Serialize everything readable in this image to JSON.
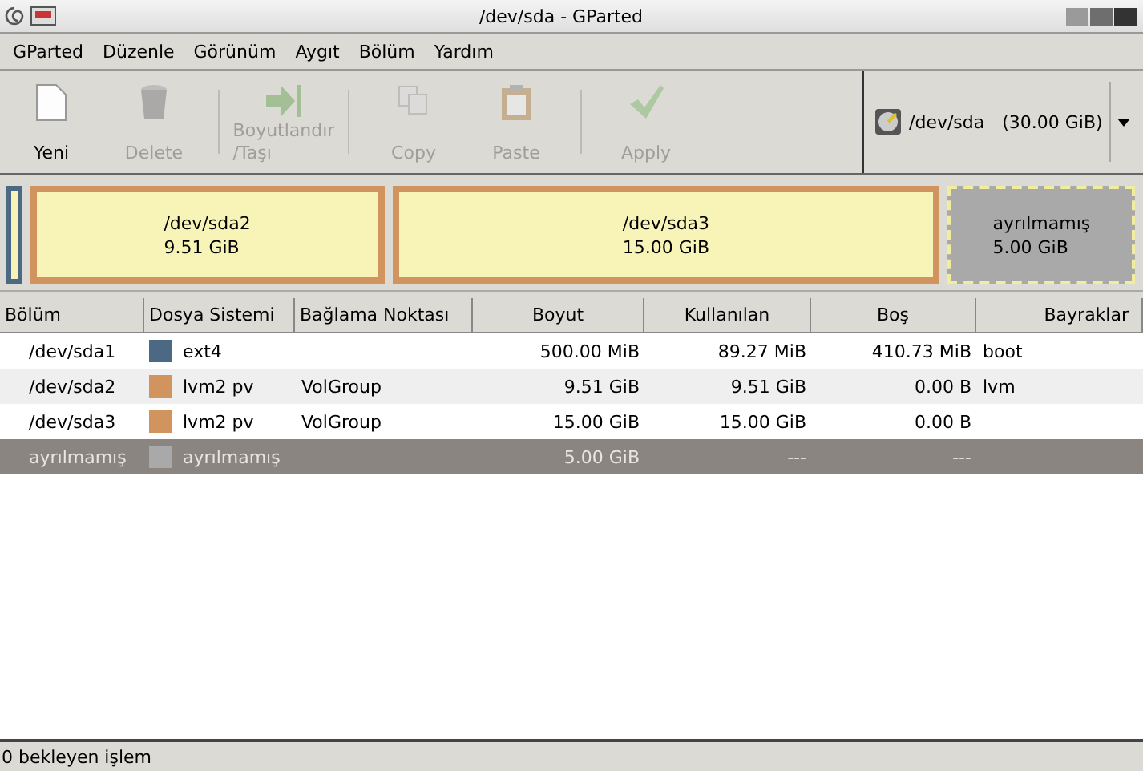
{
  "window": {
    "title": "/dev/sda - GParted"
  },
  "menu": [
    "GParted",
    "Düzenle",
    "Görünüm",
    "Aygıt",
    "Bölüm",
    "Yardım"
  ],
  "toolbar": [
    {
      "kind": "new",
      "label": "Yeni",
      "disabled": false
    },
    {
      "kind": "delete",
      "label": "Delete",
      "disabled": true
    },
    {
      "kind": "separator"
    },
    {
      "kind": "resize",
      "label": "Boyutlandır\n/Taşı",
      "disabled": true
    },
    {
      "kind": "separator"
    },
    {
      "kind": "copy",
      "label": "Copy",
      "disabled": true
    },
    {
      "kind": "paste",
      "label": "Paste",
      "disabled": true
    },
    {
      "kind": "separator"
    },
    {
      "kind": "apply",
      "label": "Apply",
      "disabled": true
    }
  ],
  "device": {
    "name": "/dev/sda",
    "size": "(30.00 GiB)"
  },
  "disk_map": [
    {
      "kind": "partition",
      "color": "#4b6983"
    },
    {
      "kind": "partition",
      "color": "#d1945f",
      "name": "/dev/sda2",
      "size": "9.51 GiB"
    },
    {
      "kind": "partition",
      "color": "#d1945f",
      "name": "/dev/sda3",
      "size": "15.00 GiB"
    },
    {
      "kind": "unallocated",
      "color": "#a9a9a9",
      "name": "ayrılmamış",
      "size": "5.00 GiB"
    }
  ],
  "table": {
    "columns": [
      "Bölüm",
      "Dosya Sistemi",
      "Bağlama Noktası",
      "Boyut",
      "Kullanılan",
      "Boş",
      "Bayraklar"
    ],
    "rows": [
      {
        "partition": "/dev/sda1",
        "color": "#4b6983",
        "filesystem": "ext4",
        "size": "500.00 MiB",
        "used": "89.27 MiB",
        "free": "410.73 MiB",
        "flags": "boot",
        "selected": false
      },
      {
        "partition": "/dev/sda2",
        "color": "#d1945f",
        "filesystem": "lvm2 pv",
        "mount": "VolGroup",
        "size": "9.51 GiB",
        "used": "9.51 GiB",
        "free": "0.00 B",
        "flags": "lvm",
        "selected": false
      },
      {
        "partition": "/dev/sda3",
        "color": "#d1945f",
        "filesystem": "lvm2 pv",
        "mount": "VolGroup",
        "size": "15.00 GiB",
        "used": "15.00 GiB",
        "free": "0.00 B",
        "selected": false
      },
      {
        "partition": "ayrılmamış",
        "color": "#a9a9a9",
        "filesystem": "ayrılmamış",
        "size": "5.00 GiB",
        "used": "---",
        "free": "---",
        "selected": true
      }
    ]
  },
  "status_bar": "0 bekleyen işlem"
}
